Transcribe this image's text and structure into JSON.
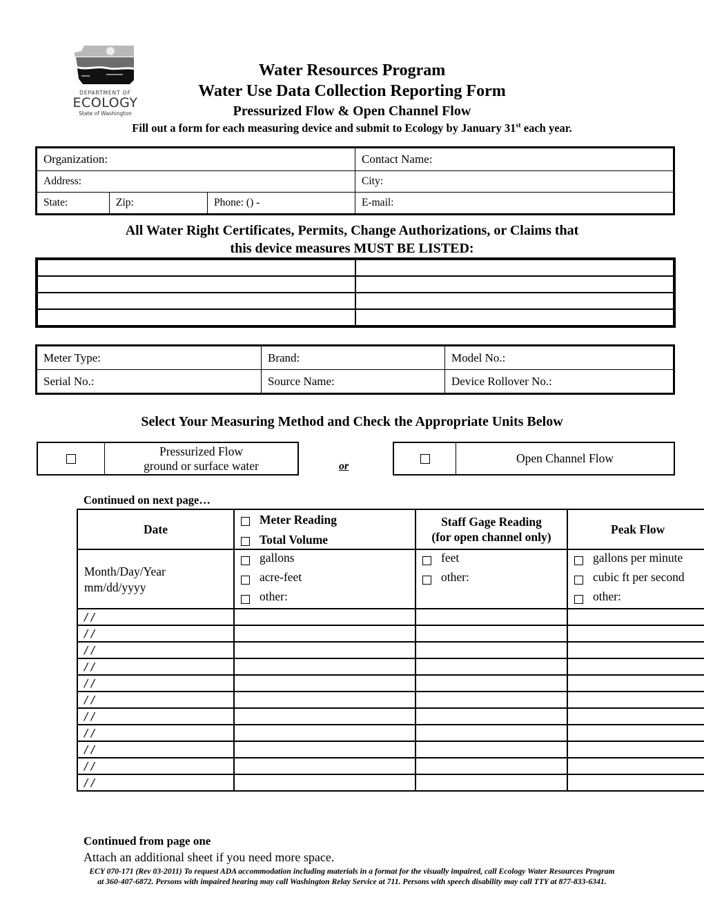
{
  "logo": {
    "icon": "washington-state-landscape-icon",
    "line1": "DEPARTMENT OF",
    "line2": "ECOLOGY",
    "line3": "State of Washington"
  },
  "header": {
    "title1": "Water Resources Program",
    "title2": "Water Use Data Collection Reporting Form",
    "subtitle": "Pressurized Flow & Open Channel Flow",
    "instruction_pre": "Fill out a form for each measuring device and submit to Ecology by January 31",
    "instruction_sup": "st",
    "instruction_post": " each year."
  },
  "contact": {
    "organization": "Organization:",
    "contact_name": "Contact Name:",
    "address": "Address:",
    "city": "City:",
    "state": "State:",
    "zip": "Zip:",
    "phone": "Phone: () -",
    "email": "E-mail:"
  },
  "rights": {
    "heading_line1": "All Water Right Certificates, Permits, Change Authorizations, or Claims that",
    "heading_line2": "this device measures MUST BE LISTED:",
    "rows": 4,
    "columns": 2
  },
  "meter": {
    "meter_type": "Meter Type:",
    "brand": "Brand:",
    "model_no": "Model No.:",
    "serial_no": "Serial No.:",
    "source_name": "Source Name:",
    "rollover_no": "Device Rollover No.:"
  },
  "method": {
    "heading": "Select Your Measuring Method and Check the Appropriate Units Below",
    "pressurized_line1": "Pressurized Flow",
    "pressurized_line2": "ground or surface water",
    "or": "or",
    "open_channel": "Open Channel Flow",
    "pressurized_checked": false,
    "open_channel_checked": false
  },
  "readings": {
    "continued_next": "Continued on next page…",
    "headers": {
      "date": "Date",
      "meter_reading": "Meter Reading",
      "total_volume": "Total Volume",
      "staff_gage_line1": "Staff Gage Reading",
      "staff_gage_line2": "(for open channel only)",
      "peak_flow": "Peak Flow"
    },
    "units": {
      "date_line1": "Month/Day/Year",
      "date_line2": "mm/dd/yyyy",
      "volume": [
        "gallons",
        "acre-feet",
        "other:"
      ],
      "gage": [
        "feet",
        "other:"
      ],
      "peak": [
        "gallons per minute",
        "cubic ft per second",
        "other:"
      ]
    },
    "rows": [
      {
        "date": "/ /"
      },
      {
        "date": "/ /"
      },
      {
        "date": "/ /"
      },
      {
        "date": "/ /"
      },
      {
        "date": "/ /"
      },
      {
        "date": "/ /"
      },
      {
        "date": "/ /"
      },
      {
        "date": "/ /"
      },
      {
        "date": "/ /"
      },
      {
        "date": "/ /"
      },
      {
        "date": "/ /"
      }
    ]
  },
  "footer": {
    "continued_from": "Continued from page one",
    "attach": "Attach an additional sheet if you need more space.",
    "legal_line1": "ECY 070-171 (Rev 03-2011) To request ADA accommodation including materials in a format for the visually impaired, call Ecology Water Resources Program",
    "legal_line2": "at 360-407-6872.  Persons with impaired hearing may call Washington Relay Service at 711.  Persons with speech disability may call TTY at 877-833-6341."
  }
}
